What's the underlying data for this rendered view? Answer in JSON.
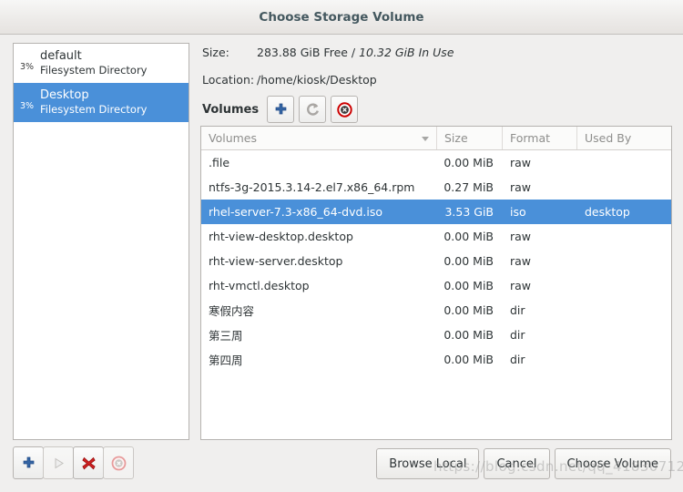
{
  "window": {
    "title": "Choose Storage Volume"
  },
  "sidebar": {
    "pools": [
      {
        "percent": "3%",
        "name": "default",
        "type": "Filesystem Directory",
        "selected": false
      },
      {
        "percent": "3%",
        "name": "Desktop",
        "type": "Filesystem Directory",
        "selected": true
      }
    ],
    "actions": [
      {
        "icon": "plus-icon",
        "name": "add-pool-button",
        "enabled": true
      },
      {
        "icon": "play-icon",
        "name": "start-pool-button",
        "enabled": false
      },
      {
        "icon": "delete-x-icon",
        "name": "delete-pool-button",
        "enabled": true
      },
      {
        "icon": "stop-icon",
        "name": "stop-pool-button",
        "enabled": false
      }
    ]
  },
  "details": {
    "size_label": "Size:",
    "size_free": "283.88 GiB Free / ",
    "size_in_use": "10.32 GiB In Use",
    "location_label": "Location:",
    "location_value": "/home/kiosk/Desktop"
  },
  "volumes_toolbar": {
    "label": "Volumes",
    "buttons": [
      {
        "icon": "plus-icon",
        "name": "add-volume-button",
        "enabled": true
      },
      {
        "icon": "refresh-icon",
        "name": "refresh-volumes-button",
        "enabled": false
      },
      {
        "icon": "delete-circle-icon",
        "name": "delete-volume-button",
        "enabled": true
      }
    ]
  },
  "table": {
    "columns": [
      "Volumes",
      "Size",
      "Format",
      "Used By"
    ],
    "sorted_by": "Volumes",
    "rows": [
      {
        "name": ".file",
        "size": "0.00 MiB",
        "format": "raw",
        "used_by": "",
        "selected": false
      },
      {
        "name": "ntfs-3g-2015.3.14-2.el7.x86_64.rpm",
        "size": "0.27 MiB",
        "format": "raw",
        "used_by": "",
        "selected": false
      },
      {
        "name": "rhel-server-7.3-x86_64-dvd.iso",
        "size": "3.53 GiB",
        "format": "iso",
        "used_by": "desktop",
        "selected": true
      },
      {
        "name": "rht-view-desktop.desktop",
        "size": "0.00 MiB",
        "format": "raw",
        "used_by": "",
        "selected": false
      },
      {
        "name": "rht-view-server.desktop",
        "size": "0.00 MiB",
        "format": "raw",
        "used_by": "",
        "selected": false
      },
      {
        "name": "rht-vmctl.desktop",
        "size": "0.00 MiB",
        "format": "raw",
        "used_by": "",
        "selected": false
      },
      {
        "name": "寒假内容",
        "size": "0.00 MiB",
        "format": "dir",
        "used_by": "",
        "selected": false
      },
      {
        "name": "第三周",
        "size": "0.00 MiB",
        "format": "dir",
        "used_by": "",
        "selected": false
      },
      {
        "name": "第四周",
        "size": "0.00 MiB",
        "format": "dir",
        "used_by": "",
        "selected": false
      }
    ]
  },
  "dialog_buttons": {
    "browse_local": "Browse Local",
    "cancel": "Cancel",
    "choose_volume": "Choose Volume"
  },
  "watermark": "https://blog.csdn.net/qq_41830712",
  "colors": {
    "selection": "#4a90d9",
    "background": "#f0efee",
    "accent_plus": "#3465a4",
    "accent_delete": "#cc0000"
  }
}
